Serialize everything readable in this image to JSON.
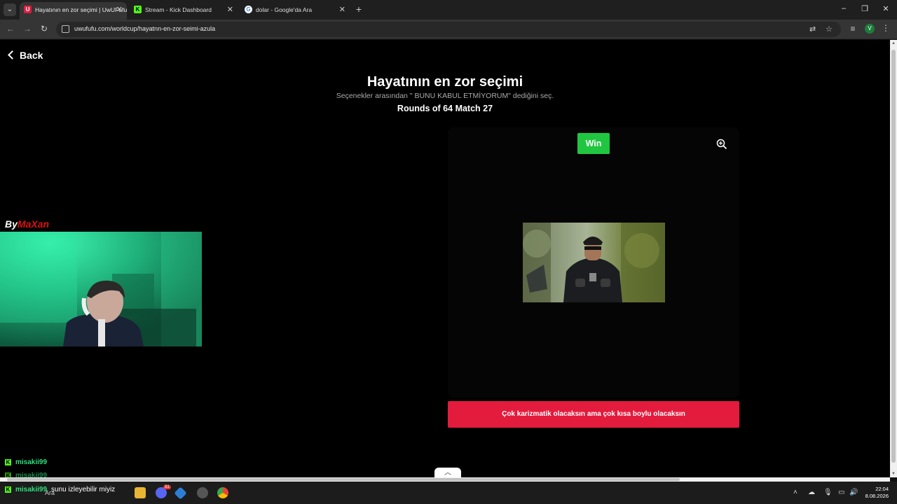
{
  "browser": {
    "tabs": [
      {
        "title": "Hayatının en zor seçimi | UwUFufu",
        "favicon": "U",
        "active": true
      },
      {
        "title": "Stream - Kick Dashboard",
        "favicon": "K",
        "active": false
      },
      {
        "title": "dolar - Google'da Ara",
        "favicon": "G",
        "active": false
      }
    ],
    "url": "uwufufu.com/worldcup/hayatnn-en-zor-seimi-azula",
    "profile_initial": "V"
  },
  "page": {
    "back_label": "Back",
    "title": "Hayatının en zor seçimi",
    "subtitle": "Seçenekler arasından \" BUNU KABUL ETMİYORUM\" dediğini seç.",
    "round_info": "Rounds of 64 Match 27",
    "candidate": {
      "badge": "Win",
      "option_label": "Çok karizmatik olacaksın ama çok kısa boylu olacaksın"
    }
  },
  "overlay": {
    "logo_by": "By",
    "logo_name": "MaXan",
    "chat": [
      {
        "user": "misakii99",
        "message": ""
      },
      {
        "user": "misakii99",
        "message": ""
      },
      {
        "user": "misakii99",
        "message": "sunu izleyebilir miyiz"
      }
    ]
  },
  "taskbar": {
    "search_placeholder": "Ara",
    "time": "22:04",
    "date": "8.08.2026",
    "discord_badge": "31"
  },
  "colors": {
    "win_badge": "#20c640",
    "option_button": "#e31b3d",
    "page_bg": "#000000",
    "chat_user": "#2ee07a"
  }
}
